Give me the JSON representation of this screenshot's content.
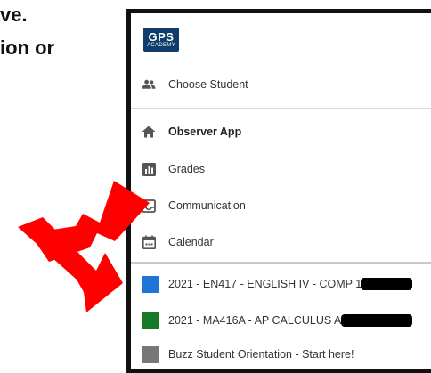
{
  "background_text": {
    "line1": "ve.",
    "line2": "ion or"
  },
  "logo": {
    "text": "GPS",
    "subtext": "ACADEMY",
    "color": "#0d3d6b"
  },
  "menu": {
    "choose_student": "Choose Student",
    "observer_app": "Observer App",
    "grades": "Grades",
    "communication": "Communication",
    "calendar": "Calendar"
  },
  "courses": [
    {
      "label": "2021 - EN417 - ENGLISH IV - COMP 101 -",
      "color": "#1f74d8"
    },
    {
      "label": "2021 - MA416A - AP CALCULUS AB -",
      "color": "#157a25"
    },
    {
      "label": "Buzz Student Orientation - Start here!",
      "color": "#777777"
    }
  ],
  "annotation": {
    "arrow_color": "#ff0000"
  }
}
